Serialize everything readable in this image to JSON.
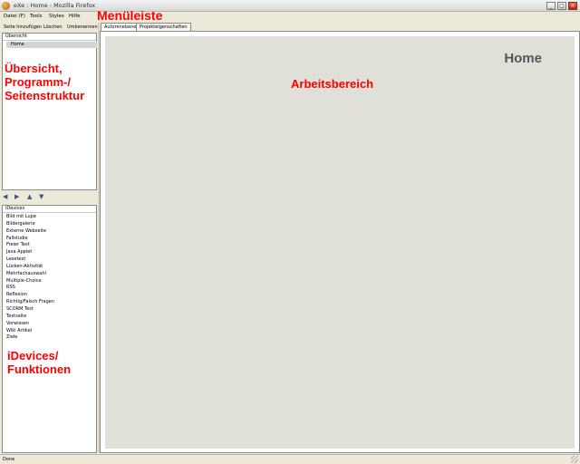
{
  "window": {
    "title": "eXe : Home - Mozilla Firefox",
    "minimize_glyph": "_",
    "maximize_glyph": "□",
    "close_glyph": "×"
  },
  "menu": {
    "items": [
      "Datei (F)",
      "Tools",
      "Styles",
      "Hilfe"
    ]
  },
  "toolbar": {
    "add_page": "Seite hinzufügen",
    "delete": "Löschen",
    "rename": "Umbenennen"
  },
  "outline": {
    "header": "Übersicht",
    "selected_node": "Home"
  },
  "arrows": {
    "promote_glyph": "◀",
    "demote_glyph": "▶",
    "up_glyph": "▲",
    "down_glyph": "▼"
  },
  "idevices": {
    "header": "iDevices",
    "items": [
      "Bild mit Lupe",
      "Bildergalerie",
      "Externe Webseite",
      "Fallstudie",
      "Freier Text",
      "Java Applet",
      "Lesetext",
      "Lücken-Aktivität",
      "Mehrfachauswahl",
      "Multiple-Choice",
      "RSS",
      "Reflexion",
      "Richtig/Falsch Fragen",
      "SCORM Test",
      "Textseite",
      "Vorwissen",
      "Wiki Artikel",
      "Ziele"
    ]
  },
  "tabs": {
    "authoring": "Autorenebene",
    "properties": "Projekteigenschaften"
  },
  "workspace": {
    "page_title": "Home"
  },
  "status": {
    "text": "Done"
  },
  "annotations": {
    "menubar": "Menüleiste",
    "outline": [
      "Übersicht,",
      "Programm-/",
      "Seitenstruktur"
    ],
    "workspace": "Arbeitsbereich",
    "idevices": [
      "iDevices/",
      "Funktionen"
    ]
  },
  "colors": {
    "annotation": "#ff0000",
    "workspace_bg": "#e0dfd8",
    "chrome_bg": "#ece9d8",
    "selected_node_bg": "#d4d4d4"
  }
}
